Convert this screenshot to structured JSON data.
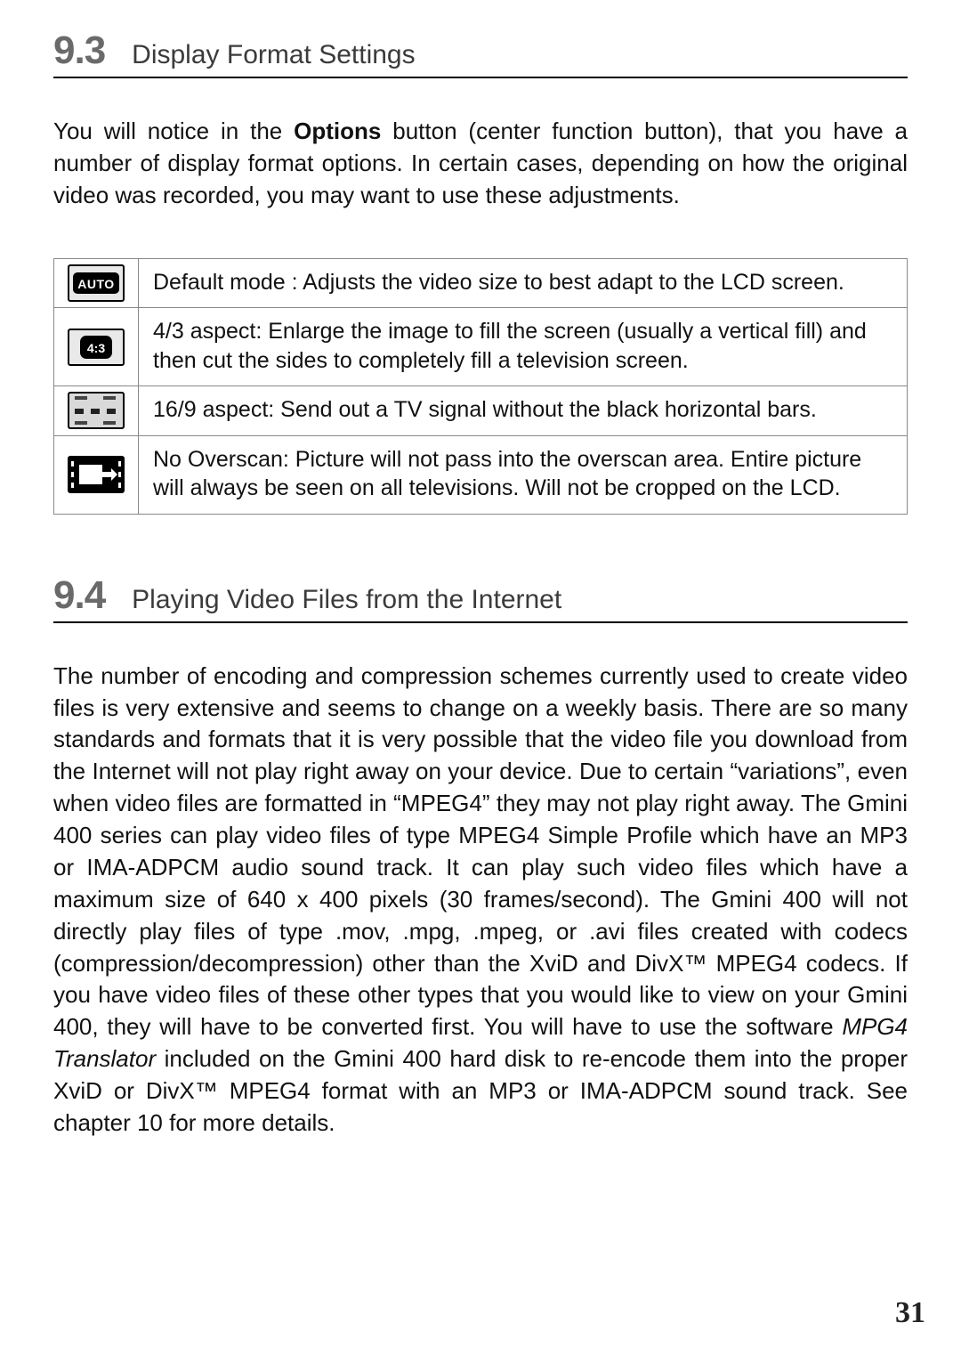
{
  "section93": {
    "number": "9.3",
    "title": "Display Format Settings",
    "intro_before_bold": "You will notice in the ",
    "intro_bold": "Options",
    "intro_after_bold": " button (center function button), that you have a number of display format options. In certain cases, depending on how the original video was recorded, you may want to use these adjustments."
  },
  "format_table": [
    {
      "icon": "auto",
      "desc": "Default mode : Adjusts the video size to best adapt to the LCD screen."
    },
    {
      "icon": "4_3",
      "desc": "4/3 aspect: Enlarge the image to fill the screen (usually a vertical fill) and then cut the sides to completely fill a television screen."
    },
    {
      "icon": "16_9",
      "desc": "16/9 aspect: Send out a TV signal without the black horizontal bars."
    },
    {
      "icon": "no_overscan",
      "desc": "No Overscan: Picture will not pass into the overscan area. Entire picture will always be seen on all televisions. Will not be cropped on the LCD."
    }
  ],
  "section94": {
    "number": "9.4",
    "title": "Playing Video Files from the Internet",
    "para_before_ital": "The number of encoding and compression schemes currently used to create video files is very extensive and seems to change on a weekly basis. There are so many standards and formats that it is very possible that the video file you download from the Internet will not play right away on your device. Due to certain “variations”, even when video files are formatted in “MPEG4” they may not play right away. The Gmini 400 series can play video files of type MPEG4 Simple Profile which have an MP3 or IMA-ADPCM audio sound track. It can play such video files which have a maximum size of 640 x 400 pixels (30 frames/second). The Gmini 400 will not directly play files of type .mov, .mpg, .mpeg, or .avi files created with codecs (compression/decompression) other than the XviD and DivX™ MPEG4 codecs. If you have video files of these other types that you would like to view on your Gmini 400, they will have to be converted first. You will have to use the software ",
    "para_ital": "MPG4 Translator",
    "para_after_ital": " included on the Gmini 400 hard disk to re-encode them into the proper XviD or DivX™ MPEG4 format with an MP3 or IMA-ADPCM sound track. See chapter 10 for more details."
  },
  "page_number": "31"
}
